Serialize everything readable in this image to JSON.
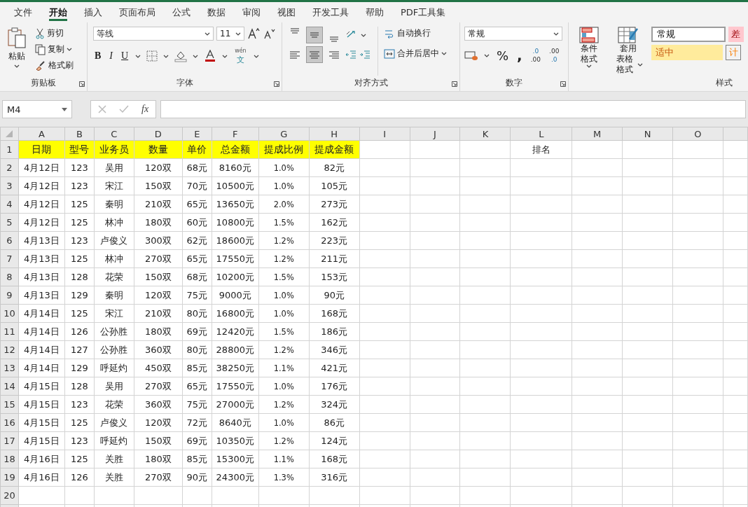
{
  "menu_tabs": [
    {
      "label": "文件",
      "selected": false
    },
    {
      "label": "开始",
      "selected": true
    },
    {
      "label": "插入",
      "selected": false
    },
    {
      "label": "页面布局",
      "selected": false
    },
    {
      "label": "公式",
      "selected": false
    },
    {
      "label": "数据",
      "selected": false
    },
    {
      "label": "审阅",
      "selected": false
    },
    {
      "label": "视图",
      "selected": false
    },
    {
      "label": "开发工具",
      "selected": false
    },
    {
      "label": "帮助",
      "selected": false
    },
    {
      "label": "PDF工具集",
      "selected": false
    }
  ],
  "ribbon": {
    "clipboard": {
      "paste": "粘贴",
      "cut": "剪切",
      "copy": "复制",
      "format_painter": "格式刷",
      "label": "剪贴板"
    },
    "font": {
      "font_name": "等线",
      "font_size": "11",
      "bold": "B",
      "italic": "I",
      "underline": "U",
      "phonetic_top": "wén",
      "phonetic_bottom": "文",
      "label": "字体"
    },
    "alignment": {
      "top_row": [
        {
          "kind": "align-top",
          "selected": false
        },
        {
          "kind": "align-middle",
          "selected": true
        },
        {
          "kind": "align-bottom",
          "selected": false
        }
      ],
      "bottom_row": [
        {
          "kind": "align-left",
          "selected": false
        },
        {
          "kind": "align-center",
          "selected": true
        },
        {
          "kind": "align-right",
          "selected": false
        }
      ],
      "wrap_text": "自动换行",
      "merge_center": "合并后居中",
      "label": "对齐方式"
    },
    "number": {
      "format": "常规",
      "percent": "%",
      "comma": ",",
      "increase_decimal": [
        ".0",
        ".00"
      ],
      "decrease_decimal": [
        ".00",
        ".0"
      ],
      "label": "数字"
    },
    "styles": {
      "conditional_format": "条件格式",
      "table_format_line1": "套用",
      "table_format_line2": "表格格式",
      "cell_styles": [
        {
          "label": "常规",
          "kind": "normal"
        },
        {
          "label": "差",
          "kind": "bad"
        },
        {
          "label": "适中",
          "kind": "neutral"
        },
        {
          "label": "计",
          "kind": "calc"
        }
      ],
      "label": "样式"
    }
  },
  "formula_bar": {
    "name_box": "M4",
    "fx": "fx"
  },
  "sheet": {
    "columns": [
      "A",
      "B",
      "C",
      "D",
      "E",
      "F",
      "G",
      "H",
      "I",
      "J",
      "K",
      "L",
      "M",
      "N",
      "O"
    ],
    "header_row": {
      "number": "1",
      "cells": [
        "日期",
        "型号",
        "业务员",
        "数量",
        "单价",
        "总金额",
        "提成比例",
        "提成金额"
      ],
      "column_l": "排名"
    },
    "rows": [
      {
        "number": "2",
        "cells": [
          "4月12日",
          "123",
          "吴用",
          "120双",
          "68元",
          "8160元",
          "1.0%",
          "82元"
        ]
      },
      {
        "number": "3",
        "cells": [
          "4月12日",
          "123",
          "宋江",
          "150双",
          "70元",
          "10500元",
          "1.0%",
          "105元"
        ]
      },
      {
        "number": "4",
        "cells": [
          "4月12日",
          "125",
          "秦明",
          "210双",
          "65元",
          "13650元",
          "2.0%",
          "273元"
        ]
      },
      {
        "number": "5",
        "cells": [
          "4月12日",
          "125",
          "林冲",
          "180双",
          "60元",
          "10800元",
          "1.5%",
          "162元"
        ]
      },
      {
        "number": "6",
        "cells": [
          "4月13日",
          "123",
          "卢俊义",
          "300双",
          "62元",
          "18600元",
          "1.2%",
          "223元"
        ]
      },
      {
        "number": "7",
        "cells": [
          "4月13日",
          "125",
          "林冲",
          "270双",
          "65元",
          "17550元",
          "1.2%",
          "211元"
        ]
      },
      {
        "number": "8",
        "cells": [
          "4月13日",
          "128",
          "花荣",
          "150双",
          "68元",
          "10200元",
          "1.5%",
          "153元"
        ]
      },
      {
        "number": "9",
        "cells": [
          "4月13日",
          "129",
          "秦明",
          "120双",
          "75元",
          "9000元",
          "1.0%",
          "90元"
        ]
      },
      {
        "number": "10",
        "cells": [
          "4月14日",
          "125",
          "宋江",
          "210双",
          "80元",
          "16800元",
          "1.0%",
          "168元"
        ]
      },
      {
        "number": "11",
        "cells": [
          "4月14日",
          "126",
          "公孙胜",
          "180双",
          "69元",
          "12420元",
          "1.5%",
          "186元"
        ]
      },
      {
        "number": "12",
        "cells": [
          "4月14日",
          "127",
          "公孙胜",
          "360双",
          "80元",
          "28800元",
          "1.2%",
          "346元"
        ]
      },
      {
        "number": "13",
        "cells": [
          "4月14日",
          "129",
          "呼延灼",
          "450双",
          "85元",
          "38250元",
          "1.1%",
          "421元"
        ]
      },
      {
        "number": "14",
        "cells": [
          "4月15日",
          "128",
          "吴用",
          "270双",
          "65元",
          "17550元",
          "1.0%",
          "176元"
        ]
      },
      {
        "number": "15",
        "cells": [
          "4月15日",
          "123",
          "花荣",
          "360双",
          "75元",
          "27000元",
          "1.2%",
          "324元"
        ]
      },
      {
        "number": "16",
        "cells": [
          "4月15日",
          "125",
          "卢俊义",
          "120双",
          "72元",
          "8640元",
          "1.0%",
          "86元"
        ]
      },
      {
        "number": "17",
        "cells": [
          "4月15日",
          "123",
          "呼延灼",
          "150双",
          "69元",
          "10350元",
          "1.2%",
          "124元"
        ]
      },
      {
        "number": "18",
        "cells": [
          "4月16日",
          "125",
          "关胜",
          "180双",
          "85元",
          "15300元",
          "1.1%",
          "168元"
        ]
      },
      {
        "number": "19",
        "cells": [
          "4月16日",
          "126",
          "关胜",
          "270双",
          "90元",
          "24300元",
          "1.3%",
          "316元"
        ]
      },
      {
        "number": "20",
        "cells": []
      }
    ]
  }
}
